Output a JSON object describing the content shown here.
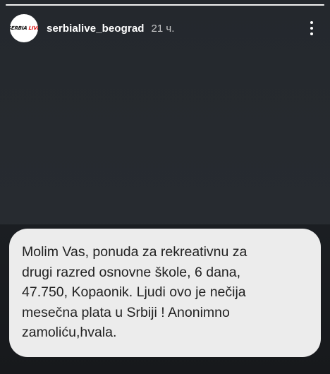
{
  "story": {
    "progress": 1.0
  },
  "header": {
    "avatar_logo": {
      "word1": "SERBIA",
      "word2": "LIVE"
    },
    "username": "serbialive_beograd",
    "time_ago": "21 ч.",
    "more_icon": "more-vertical-icon"
  },
  "message": {
    "text": "Molim Vas, ponuda za rekreativnu za\ndrugi razred osnovne škole, 6 dana,\n47.750, Kopaonik. Ljudi ovo je nečija\nmesečna plata u Srbiji ! Anonimno\nzamoliću,hvala."
  },
  "colors": {
    "background": "#272b30",
    "bubble": "#ececec",
    "bubble_text": "#222222",
    "accent_live": "#dd1111"
  }
}
